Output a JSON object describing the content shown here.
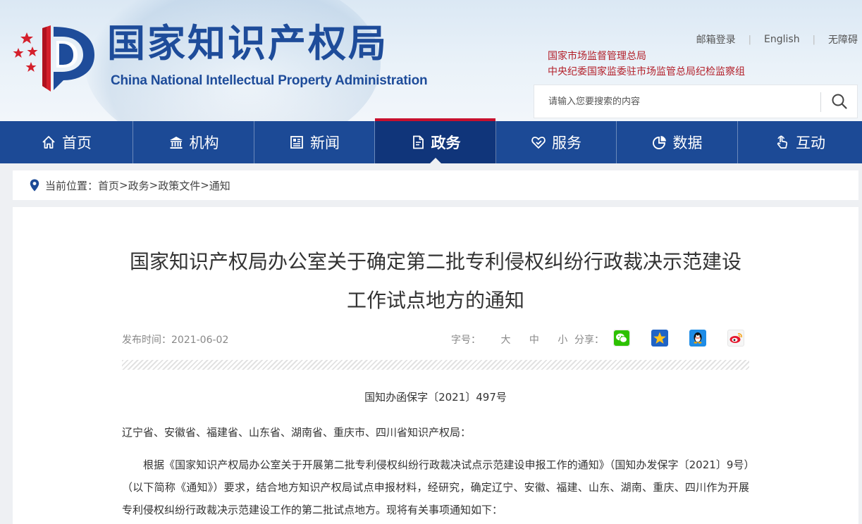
{
  "header": {
    "title_cn": "国家知识产权局",
    "title_en": "China National Intellectual Property Administration",
    "links": [
      "邮箱登录",
      "English",
      "无障碍"
    ],
    "orgs": [
      "国家市场监督管理总局",
      "中央纪委国家监委驻市场监管总局纪检监察组"
    ],
    "search_placeholder": "请输入您要搜索的内容"
  },
  "nav": {
    "items": [
      {
        "label": "首页",
        "icon": "home-icon"
      },
      {
        "label": "机构",
        "icon": "institution-icon"
      },
      {
        "label": "新闻",
        "icon": "news-icon"
      },
      {
        "label": "政务",
        "icon": "government-affairs-icon",
        "active": true
      },
      {
        "label": "服务",
        "icon": "service-icon"
      },
      {
        "label": "数据",
        "icon": "data-pie-icon"
      },
      {
        "label": "互动",
        "icon": "interaction-hand-icon"
      }
    ]
  },
  "breadcrumb": {
    "prefix": "当前位置：",
    "items": [
      "首页",
      "政务",
      "政策文件",
      "通知"
    ],
    "separator": ">"
  },
  "article": {
    "title_line1": "国家知识产权局办公室关于确定第二批专利侵权纠纷行政裁决示范建设",
    "title_line2": "工作试点地方的通知",
    "publish_label": "发布时间：",
    "publish_date": "2021-06-02",
    "font_size_label": "字号：",
    "font_sizes": [
      "大",
      "中",
      "小"
    ],
    "share_label": "分享：",
    "share_icons": [
      "wechat-icon",
      "qzone-star-icon",
      "qq-penguin-icon",
      "weibo-icon"
    ],
    "doc_number": "国知办函保字〔2021〕497号",
    "addressee": "辽宁省、安徽省、福建省、山东省、湖南省、重庆市、四川省知识产权局：",
    "paragraph1": "根据《国家知识产权局办公室关于开展第二批专利侵权纠纷行政裁决试点示范建设申报工作的通知》（国知办发保字〔2021〕9号）（以下简称《通知》）要求，结合地方知识产权局试点申报材料，经研究，确定辽宁、安徽、福建、山东、湖南、重庆、四川作为开展专利侵权纠纷行政裁决示范建设工作的第二批试点地方。现将有关事项通知如下："
  },
  "colors": {
    "brand_blue": "#1c4a96",
    "active_nav": "#10357a",
    "accent_red": "#c8102e",
    "org_red": "#b3202a"
  }
}
